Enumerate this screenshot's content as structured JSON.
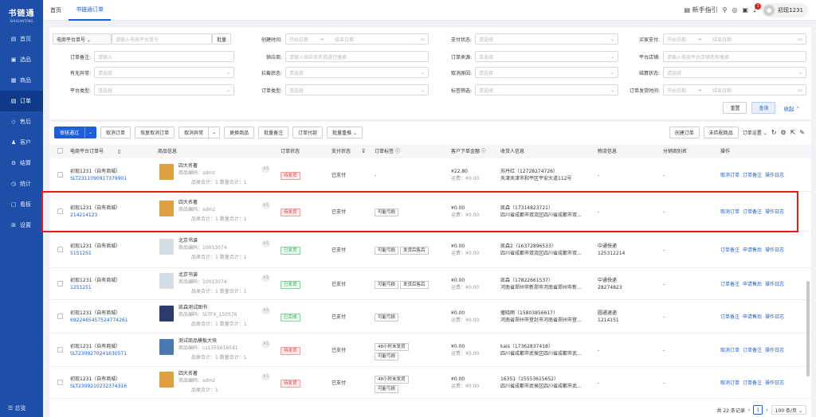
{
  "sidebar": {
    "logo": "书链通",
    "logo_sub": "SHULIANTONG",
    "items": [
      {
        "icon": "▤",
        "label": "首页"
      },
      {
        "icon": "▣",
        "label": "选品"
      },
      {
        "icon": "▦",
        "label": "商品"
      },
      {
        "icon": "▤",
        "label": "订单"
      },
      {
        "icon": "◇",
        "label": "售后"
      },
      {
        "icon": "♟",
        "label": "客户"
      },
      {
        "icon": "⚙",
        "label": "结算"
      },
      {
        "icon": "◷",
        "label": "统计"
      },
      {
        "icon": "▢",
        "label": "看板"
      },
      {
        "icon": "⊞",
        "label": "设置"
      }
    ],
    "footer": "☰ 总览"
  },
  "topbar": {
    "tabs": [
      "首页",
      "书链通订单"
    ],
    "guide": "▤ 新手指引",
    "notice_count": "1",
    "username": "初现1231"
  },
  "filters": {
    "platform_order_select": "电商平台单号 ⌄",
    "platform_order_ph": "请输入电商平台单号",
    "batch": "批量",
    "create_time_label": "创建时间:",
    "start_date": "开始日期",
    "to": "→",
    "end_date": "结束日期",
    "pay_status_label": "支付状态:",
    "buyer_pay_label": "买家支付:",
    "remark_label": "订单备注:",
    "remark_ph": "请输入",
    "supplier_label": "供应商:",
    "supplier_ph": "请输入供应商名称进行搜索",
    "source_label": "订单来源:",
    "platform_shop_label": "平台店铺:",
    "platform_shop_ph": "请输入电商平台店铺名称搜索",
    "abnormal_label": "有无异常:",
    "intercept_label": "拦截状态:",
    "cancel_reason_label": "取消原因:",
    "settle_label": "结算状态:",
    "platform_type_label": "平台类型:",
    "order_type_label": "订单类型:",
    "tag_filter_label": "标签筛选:",
    "ship_time_label": "订单发货时间:",
    "select_ph": "请选择",
    "reset": "重置",
    "query": "查询",
    "collapse": "收起 ⌃"
  },
  "toolbar": {
    "approve": "审核通过",
    "approve_caret": "⌄",
    "cancel_order": "取消订单",
    "restore": "恢复取消订单",
    "cancel_abnormal": "取消异常",
    "cancel_abnormal_caret": "⌄",
    "change_goods": "更换商品",
    "batch_remark": "批量备注",
    "order_pay": "订单付款",
    "batch_repush": "批量重推 ⌄",
    "create_order": "创建订单",
    "unmatched": "未匹配商品",
    "settings": "订单设置 ⌄"
  },
  "columns": {
    "platform_no": "电商平台订单号",
    "goods": "商品信息",
    "status": "订单状态",
    "pay": "支付状态",
    "tag": "订单标签 ⓘ",
    "amount": "客户下单金额 ⓘ",
    "receiver": "收货人信息",
    "logistics": "物流信息",
    "dist_name": "分销商别名",
    "ops": "操作"
  },
  "rows": [
    {
      "shop": "初现1231（自有商城）",
      "order_no": "SLT2311090917379901",
      "title": "四大名著",
      "code": "商品编码：sdmz",
      "qty": "×1",
      "meta": "品类合计：1 数量合计：1",
      "status": "待发货",
      "status_type": "x",
      "pay": "已支付",
      "tags": [
        "-"
      ],
      "amount": "¥22.80",
      "freight": "运费：¥0.00",
      "receiver": "苏丹红（12728274726）",
      "addr": "天津天津市和平区平安大道112号",
      "logistics": "-",
      "logistics2": "",
      "dist": "-",
      "ops": [
        "取消订单",
        "订单备注",
        "操作日志"
      ],
      "thumb": "#e0a040"
    },
    {
      "shop": "初现1231（自有商城）",
      "order_no": "214214123",
      "title": "四大名著",
      "code": "商品编码：sdmz",
      "qty": "×1",
      "meta": "品类合计：1 数量合计：1",
      "status": "待发货",
      "status_type": "x",
      "pay": "已支付",
      "tags": [
        "可能亏损"
      ],
      "amount": "¥0.00",
      "freight": "运费：¥0.00",
      "receiver": "凯森（17314823721）",
      "addr": "四川省成都市双流区四川省成都市双...",
      "logistics": "-",
      "logistics2": "",
      "dist": "-",
      "ops": [
        "取消订单",
        "订单备注",
        "操作日志"
      ],
      "thumb": "#e0a040"
    },
    {
      "shop": "初现1231（自有商城）",
      "order_no": "5151251",
      "title": "北京书谱",
      "code": "商品编码：10013074",
      "qty": "×1",
      "meta": "品类合计：1 数量合计：1",
      "status": "已发货",
      "status_type": "g",
      "pay": "已支付",
      "tags": [
        "可能亏损",
        "发货后售后"
      ],
      "amount": "¥0.00",
      "freight": "运费：¥0.00",
      "receiver": "凯森2（16372896533）",
      "addr": "四川省成都市双流区四川省成都市双...",
      "logistics": "中通快递",
      "logistics2": "125312214",
      "dist": "-",
      "ops": [
        "订单备注",
        "申请售后",
        "操作日志"
      ],
      "thumb": "#d8dce4"
    },
    {
      "shop": "初现1231（自有商城）",
      "order_no": "1251251",
      "title": "北京书谱",
      "code": "商品编码：10013074",
      "qty": "×1",
      "meta": "品类合计：1 数量合计：1",
      "status": "已发货",
      "status_type": "g",
      "pay": "已支付",
      "tags": [
        "可能亏损",
        "发货后售后"
      ],
      "amount": "¥0.00",
      "freight": "运费：¥0.00",
      "receiver": "凯森（17822661537）",
      "addr": "河南省郑州市新郑市河南省郑州市新...",
      "logistics": "中通快递",
      "logistics2": "28274823",
      "dist": "-",
      "ops": [
        "订单备注",
        "申请售后",
        "操作日志"
      ],
      "thumb": "#d8dce4"
    },
    {
      "shop": "初现1231（自有商城）",
      "order_no": "6922465457524774261",
      "title": "凯森测试图书",
      "code": "商品编码：SLTFX_150576",
      "qty": "×1",
      "meta": "品类合计：1 数量合计：1",
      "status": "已完成",
      "status_type": "g",
      "pay": "已支付",
      "tags": [
        "可能亏损"
      ],
      "amount": "¥0.00",
      "freight": "运费：¥0.00",
      "receiver": "撞晓雨（15803856617）",
      "addr": "河南省郑州市登封市河南省郑州市登...",
      "logistics": "圆通速递",
      "logistics2": "1214151",
      "dist": "-",
      "ops": [
        "订单备注",
        "申请售后",
        "操作日志"
      ],
      "thumb": "#2a3a6a"
    },
    {
      "shop": "初现1231（自有商城）",
      "order_no": "SLT2309270241630571",
      "title": "测试商品模板大块",
      "code": "商品编码：cs1355616541",
      "qty": "×1",
      "meta": "品类合计：1 数量合计：1",
      "status": "待发货",
      "status_type": "x",
      "pay": "已支付",
      "tags": [
        "48小时未发货",
        "可能亏损"
      ],
      "amount": "¥0.00",
      "freight": "运费：¥0.00",
      "receiver": "kais（17362837418）",
      "addr": "四川省成都市武侯区四川省成都市武...",
      "logistics": "-",
      "logistics2": "",
      "dist": "-",
      "ops": [
        "取消订单",
        "订单备注",
        "操作日志"
      ],
      "thumb": "#4a7ab0"
    },
    {
      "shop": "初现1231（自有商城）",
      "order_no": "SLT2309210232374316",
      "title": "四大名著",
      "code": "商品编码：sdmz",
      "qty": "×1",
      "meta": "品类合计：1",
      "status": "待发货",
      "status_type": "x",
      "pay": "已支付",
      "tags": [
        "48小时未发货",
        "可能亏损"
      ],
      "amount": "¥0.00",
      "freight": "运费：¥0.00",
      "receiver": "16351（15553615652）",
      "addr": "四川省成都市武侯区四川省成都市武...",
      "logistics": "-",
      "logistics2": "",
      "dist": "-",
      "ops": [
        "取消订单",
        "订单备注",
        "操作日志"
      ],
      "thumb": "#e0a040"
    }
  ],
  "pagination": {
    "total": "共 22 条记录",
    "prev": "‹",
    "page": "1",
    "next": "›",
    "size": "100 条/页 ⌄"
  },
  "colors": {
    "accent": "#1e5fd6",
    "sidebar": "#1e4fa8",
    "highlight": "#e81b1b"
  }
}
